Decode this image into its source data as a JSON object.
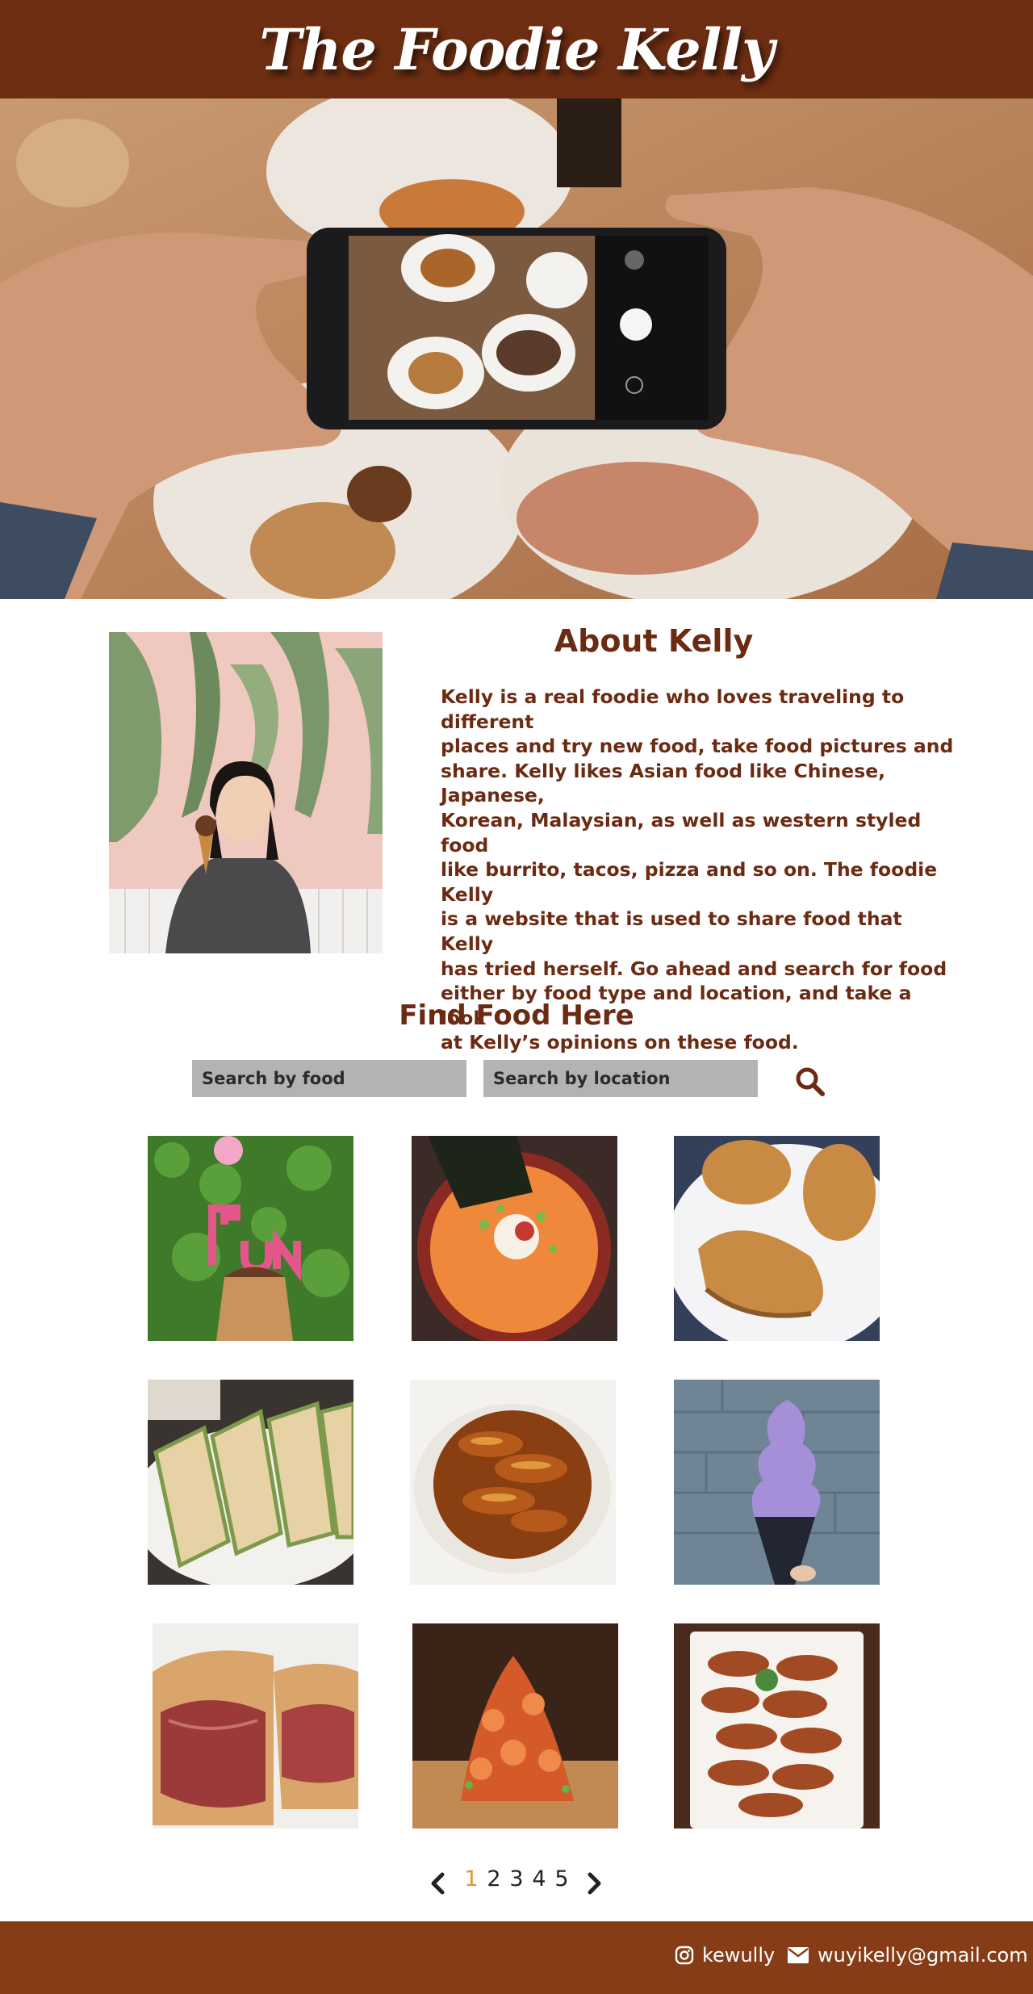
{
  "header": {
    "title": "The Foodie Kelly"
  },
  "about": {
    "title": "About Kelly",
    "lines": [
      "Kelly is a real foodie who loves traveling to different",
      "places and try new food, take food pictures and",
      "share. Kelly likes Asian food like Chinese, Japanese,",
      "Korean, Malaysian, as well as western styled food",
      "like burrito, tacos, pizza and so on. The foodie Kelly",
      "is a website that is used to share food that Kelly",
      "has tried herself. Go ahead and search for food",
      "either by food type and location, and take a look",
      "at Kelly’s opinions on these food."
    ]
  },
  "find": {
    "title": "Find Food Here",
    "food_placeholder": "Search by food",
    "location_placeholder": "Search by location",
    "search_icon": "search-icon"
  },
  "gallery": {
    "tile_icons": [
      "fun-dessert-shake",
      "ramen-bowl",
      "pastries",
      "scallion-pancakes",
      "glazed-dish",
      "purple-soft-serve",
      "beef-sandwich",
      "lobster-dish",
      "fried-chicken-wings"
    ]
  },
  "pagination": {
    "pages": [
      "1",
      "2",
      "3",
      "4",
      "5"
    ],
    "current": "1",
    "prev_icon": "chevron-left-icon",
    "next_icon": "chevron-right-icon",
    "active_color": "#d89a2a"
  },
  "footer": {
    "instagram": "kewully",
    "email": "wuyikelly@gmail.com",
    "background": "#863d17"
  },
  "colors": {
    "brand": "#6e2e12",
    "text": "#6b2a12"
  }
}
